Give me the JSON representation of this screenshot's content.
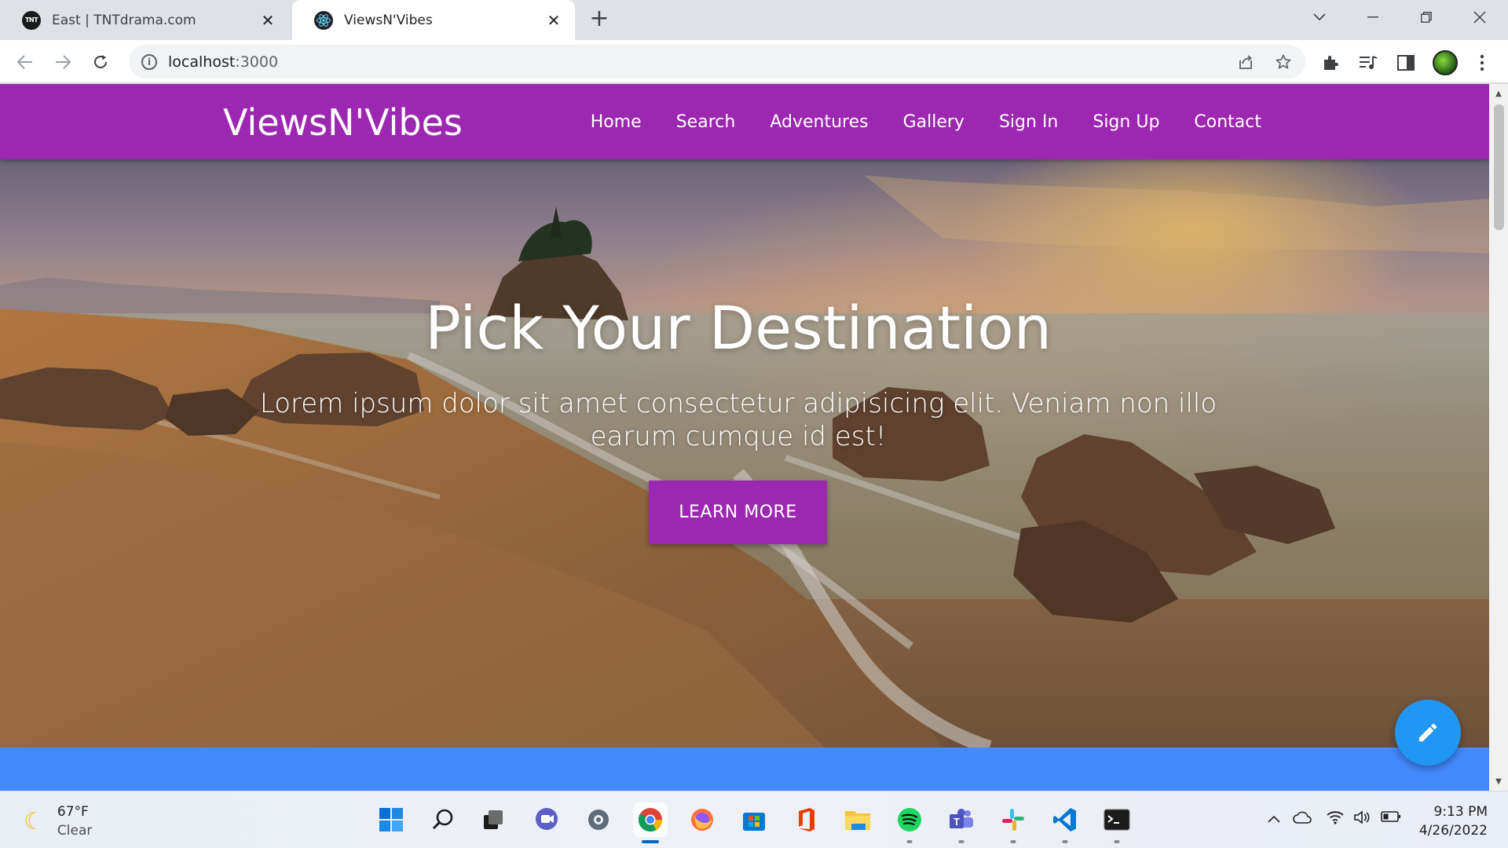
{
  "browser": {
    "tabs": [
      {
        "title": "East | TNTdrama.com",
        "favicon": "TNT",
        "active": false
      },
      {
        "title": "ViewsN'Vibes",
        "favicon": "react-icon",
        "active": true
      }
    ],
    "address": {
      "host": "localhost",
      "port": ":3000"
    }
  },
  "site": {
    "brand": "ViewsN'Vibes",
    "nav": [
      "Home",
      "Search",
      "Adventures",
      "Gallery",
      "Sign In",
      "Sign Up",
      "Contact"
    ],
    "accent_color": "#9c27b0",
    "band_color": "#448aff",
    "fab_color": "#2196f3"
  },
  "hero": {
    "title": "Pick Your Destination",
    "subtitle": "Lorem ipsum dolor sit amet consectetur adipisicing elit. Veniam non illo earum cumque id est!",
    "button": "LEARN MORE"
  },
  "taskbar": {
    "weather": {
      "temp": "67°F",
      "condition": "Clear"
    },
    "time": "9:13 PM",
    "date": "4/26/2022"
  }
}
